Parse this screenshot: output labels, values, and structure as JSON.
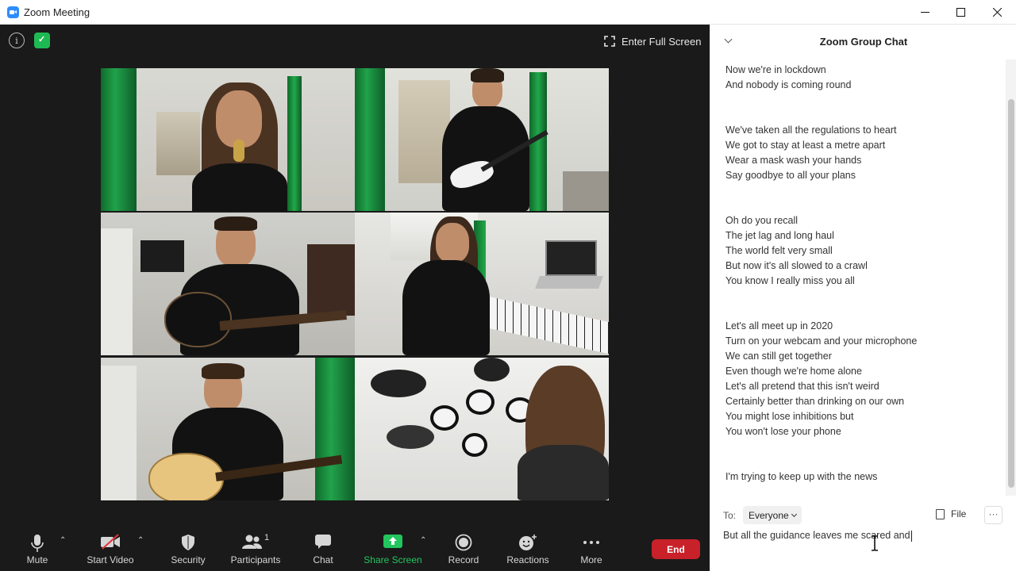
{
  "window": {
    "title": "Zoom Meeting"
  },
  "meeting": {
    "fullscreen_label": "Enter Full Screen"
  },
  "participants_tiles": [
    "singer",
    "electric-guitarist",
    "acoustic-guitarist",
    "keyboardist",
    "bassist",
    "drummer"
  ],
  "toolbar": {
    "mute": "Mute",
    "start_video": "Start Video",
    "security": "Security",
    "participants": "Participants",
    "participants_count": "1",
    "chat": "Chat",
    "share_screen": "Share Screen",
    "record": "Record",
    "reactions": "Reactions",
    "more": "More",
    "end": "End"
  },
  "chat": {
    "title": "Zoom Group Chat",
    "lines": [
      "Now we're in lockdown",
      "And nobody is coming round",
      "",
      "",
      "We've taken all the regulations to heart",
      "We got to stay at least a metre apart",
      "Wear a mask wash your hands",
      "Say goodbye to all your plans",
      "",
      "",
      "Oh do you recall",
      "The jet lag and long haul",
      "The world felt very small",
      "But now it's all slowed to a crawl",
      "You know I really miss you all",
      "",
      "",
      "Let's all meet up in 2020",
      "Turn on your webcam and your microphone",
      "We can still get together",
      "Even though we're home alone",
      "Let's all pretend that this isn't weird",
      "Certainly better than drinking on our own",
      "You might lose inhibitions but",
      "You won't lose your phone",
      "",
      "",
      "I'm trying to keep up with the news"
    ],
    "to_label": "To:",
    "to_value": "Everyone",
    "file_label": "File",
    "more_label": "···",
    "input_value": "But all the guidance leaves me scared and"
  },
  "colors": {
    "share_green": "#22c55e",
    "end_red": "#c9212a",
    "accent_blue": "#2d8cff"
  }
}
